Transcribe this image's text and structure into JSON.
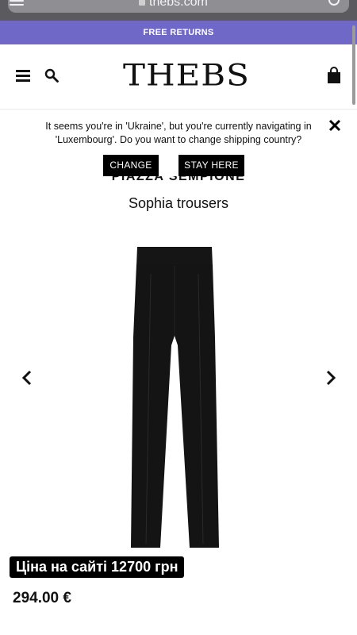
{
  "browser": {
    "url": "thebs.com",
    "icons": [
      "menu-icon",
      "lock-icon",
      "refresh-icon"
    ]
  },
  "promo": {
    "text": "FREE RETURNS",
    "background": "#6f68c6"
  },
  "header": {
    "logo_text": "THEBS",
    "icons": [
      "hamburger-icon",
      "search-icon",
      "shopping-bag-icon"
    ]
  },
  "country_popup": {
    "message": "It seems you're in 'Ukraine', but you're currently navigating in 'Luxembourg'. Do you want to change shipping country?",
    "change_label": "CHANGE",
    "stay_label": "STAY HERE",
    "close_icon": "close-icon"
  },
  "product": {
    "brand": "PIAZZA SEMPIONE",
    "title": "Sophia trousers",
    "image": "black-trousers",
    "overlay_price": "Ціна на сайті 12700 грн",
    "price": "294.00 €"
  },
  "colors": {
    "accent": "#6f68c6",
    "button": "#000000"
  }
}
